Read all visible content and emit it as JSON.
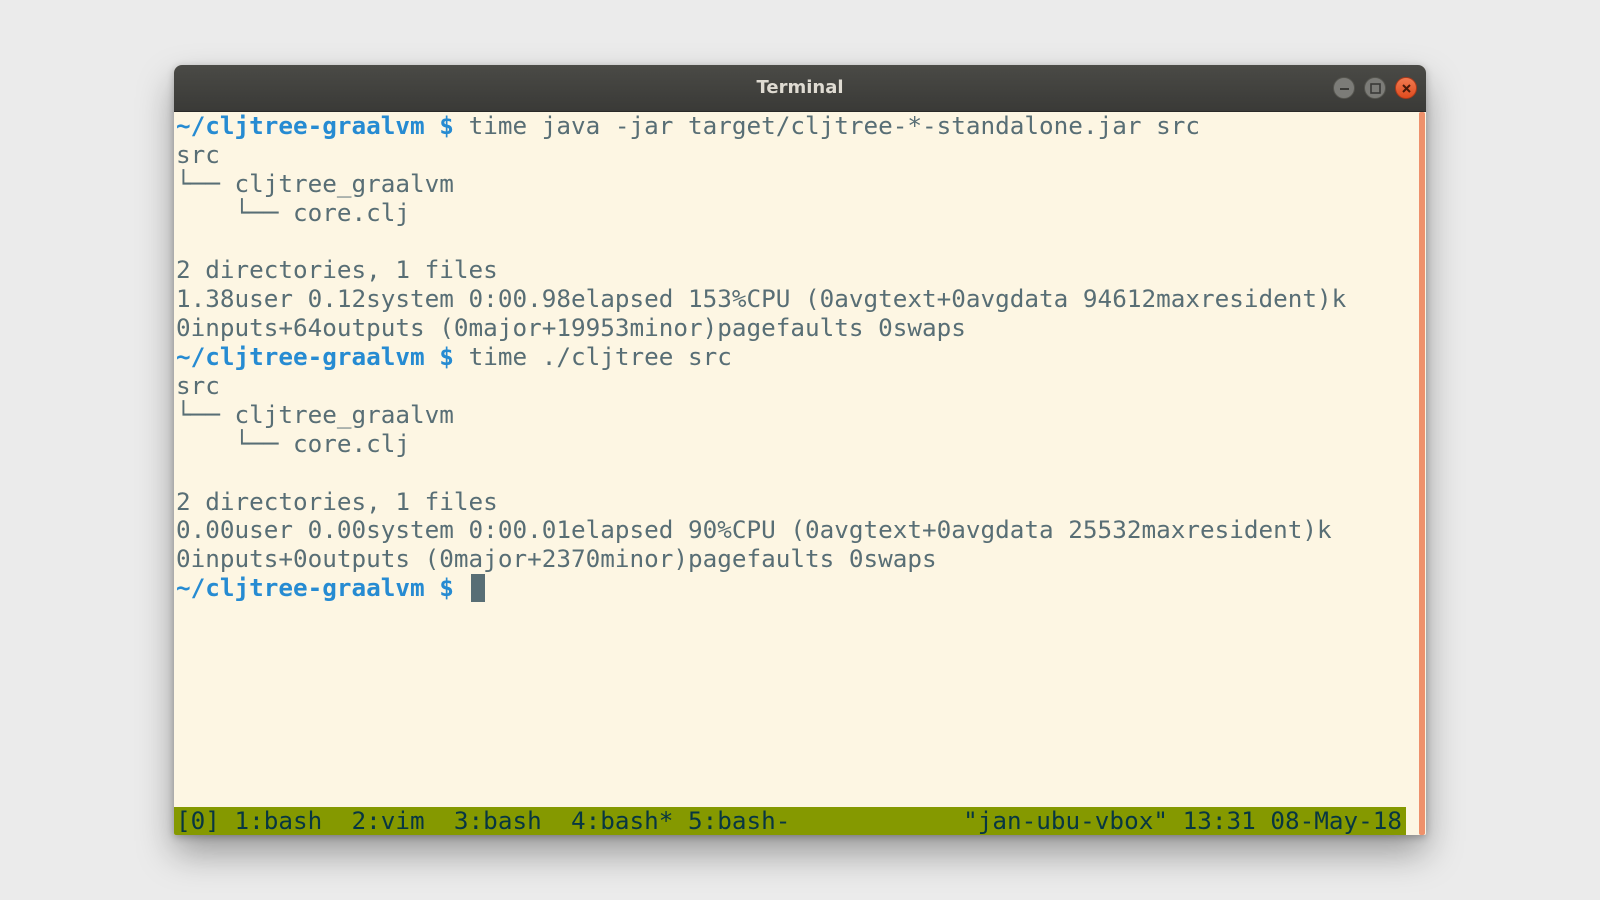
{
  "window": {
    "title": "Terminal"
  },
  "terminal": {
    "lines": [
      {
        "prompt": "~/cljtree-graalvm $",
        "text": " time java -jar target/cljtree-*-standalone.jar src"
      },
      {
        "prompt": "",
        "text": "src"
      },
      {
        "prompt": "",
        "text": "└── cljtree_graalvm"
      },
      {
        "prompt": "",
        "text": "    └── core.clj"
      },
      {
        "prompt": "",
        "text": ""
      },
      {
        "prompt": "",
        "text": "2 directories, 1 files"
      },
      {
        "prompt": "",
        "text": "1.38user 0.12system 0:00.98elapsed 153%CPU (0avgtext+0avgdata 94612maxresident)k"
      },
      {
        "prompt": "",
        "text": "0inputs+64outputs (0major+19953minor)pagefaults 0swaps"
      },
      {
        "prompt": "~/cljtree-graalvm $",
        "text": " time ./cljtree src"
      },
      {
        "prompt": "",
        "text": "src"
      },
      {
        "prompt": "",
        "text": "└── cljtree_graalvm"
      },
      {
        "prompt": "",
        "text": "    └── core.clj"
      },
      {
        "prompt": "",
        "text": ""
      },
      {
        "prompt": "",
        "text": "2 directories, 1 files"
      },
      {
        "prompt": "",
        "text": "0.00user 0.00system 0:00.01elapsed 90%CPU (0avgtext+0avgdata 25532maxresident)k"
      },
      {
        "prompt": "",
        "text": "0inputs+0outputs (0major+2370minor)pagefaults 0swaps"
      },
      {
        "prompt": "~/cljtree-graalvm $",
        "text": " ",
        "cursor": true
      }
    ]
  },
  "tmux": {
    "left": "[0] 1:bash  2:vim  3:bash  4:bash* 5:bash-",
    "right": "\"jan-ubu-vbox\" 13:31 08-May-18"
  },
  "colors": {
    "background": "#fdf6e3",
    "foreground": "#586e75",
    "prompt": "#268bd2",
    "statusbar": "#859900",
    "scrollbar": "#ee916b",
    "close_button": "#e55b2e"
  }
}
